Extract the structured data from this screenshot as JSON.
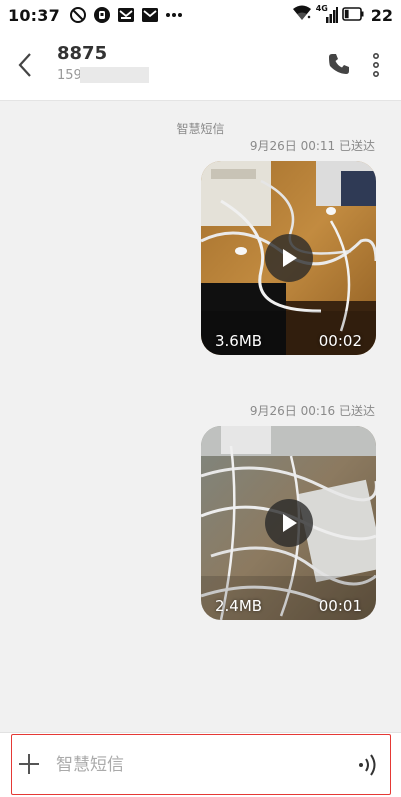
{
  "status_bar": {
    "time": "10:37",
    "network_label": "4G",
    "battery_level": "22",
    "icons": [
      "do-not-disturb-icon",
      "app-notification-icon",
      "mail-notification-icon",
      "mail-notification-icon",
      "more-notifications-icon",
      "wifi-icon",
      "cellular-signal-icon",
      "battery-icon"
    ]
  },
  "header": {
    "contact_name": "8875",
    "contact_number": "159",
    "back_icon": "back-icon",
    "call_icon": "phone-icon",
    "more_icon": "more-vertical-icon"
  },
  "conversation": {
    "sender_label": "智慧短信",
    "messages": [
      {
        "timestamp": "9月26日 00:11  已送达",
        "type": "video",
        "size": "3.6MB",
        "duration": "00:02"
      },
      {
        "timestamp": "9月26日 00:16  已送达",
        "type": "video",
        "size": "2.4MB",
        "duration": "00:01"
      }
    ]
  },
  "input": {
    "placeholder": "智慧短信",
    "value": "",
    "add_icon": "plus-icon",
    "voice_icon": "voice-icon"
  },
  "colors": {
    "background": "#f1f1f1",
    "header_bg": "#ffffff",
    "highlight_border": "#e53935",
    "secondary_text": "#8a8a8a"
  }
}
